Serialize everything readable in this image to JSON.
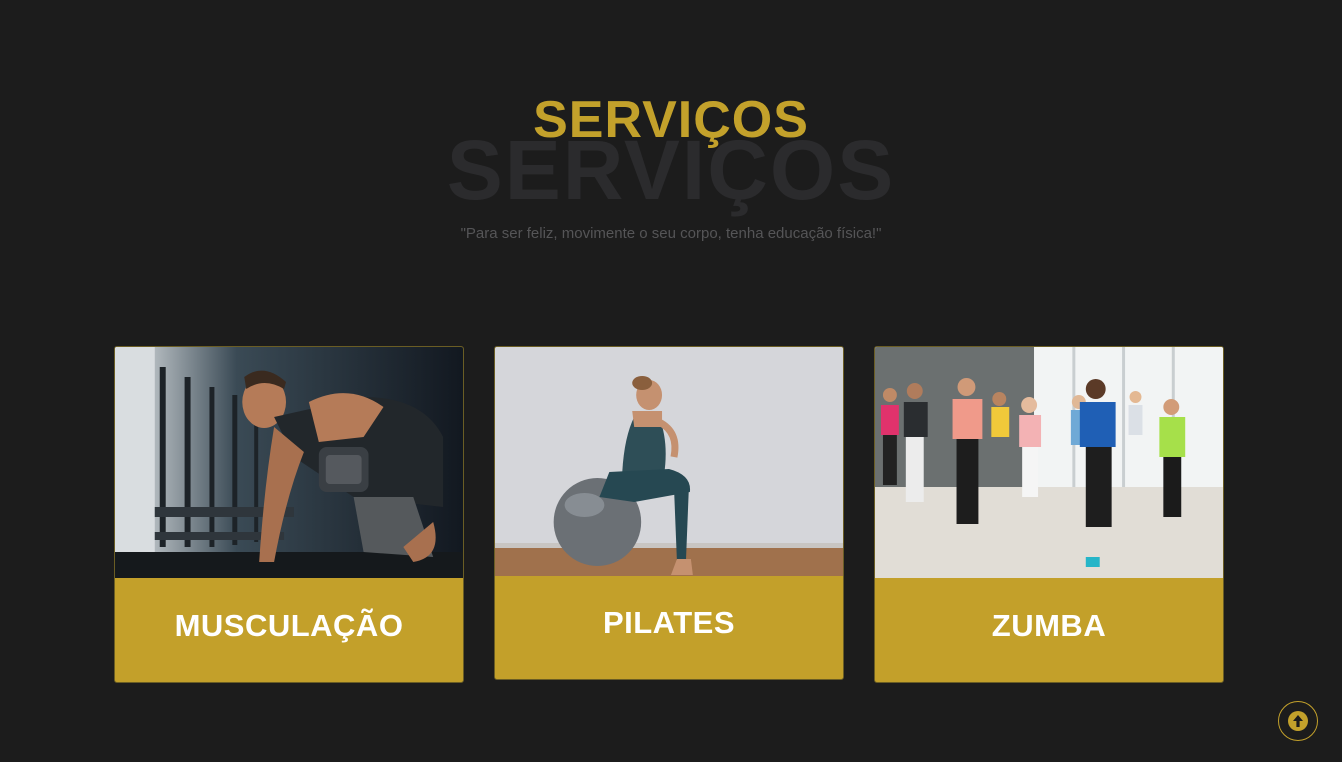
{
  "section": {
    "title": "SERVIÇOS",
    "title_shadow": "SERVIÇOS",
    "subtitle": "\"Para ser feliz, movimente o seu corpo, tenha educação física!\""
  },
  "services": [
    {
      "label": "MUSCULAÇÃO",
      "image": "weightlifting-man-dumbbell-photo"
    },
    {
      "label": "PILATES",
      "image": "woman-on-pilates-ball-photo"
    },
    {
      "label": "ZUMBA",
      "image": "group-zumba-class-photo"
    }
  ],
  "scroll_top": {
    "icon": "arrow-up-icon"
  },
  "colors": {
    "background": "#1c1c1c",
    "accent": "#c3a12b",
    "card_label_bg": "#c3a02a",
    "subtitle": "#555557"
  }
}
